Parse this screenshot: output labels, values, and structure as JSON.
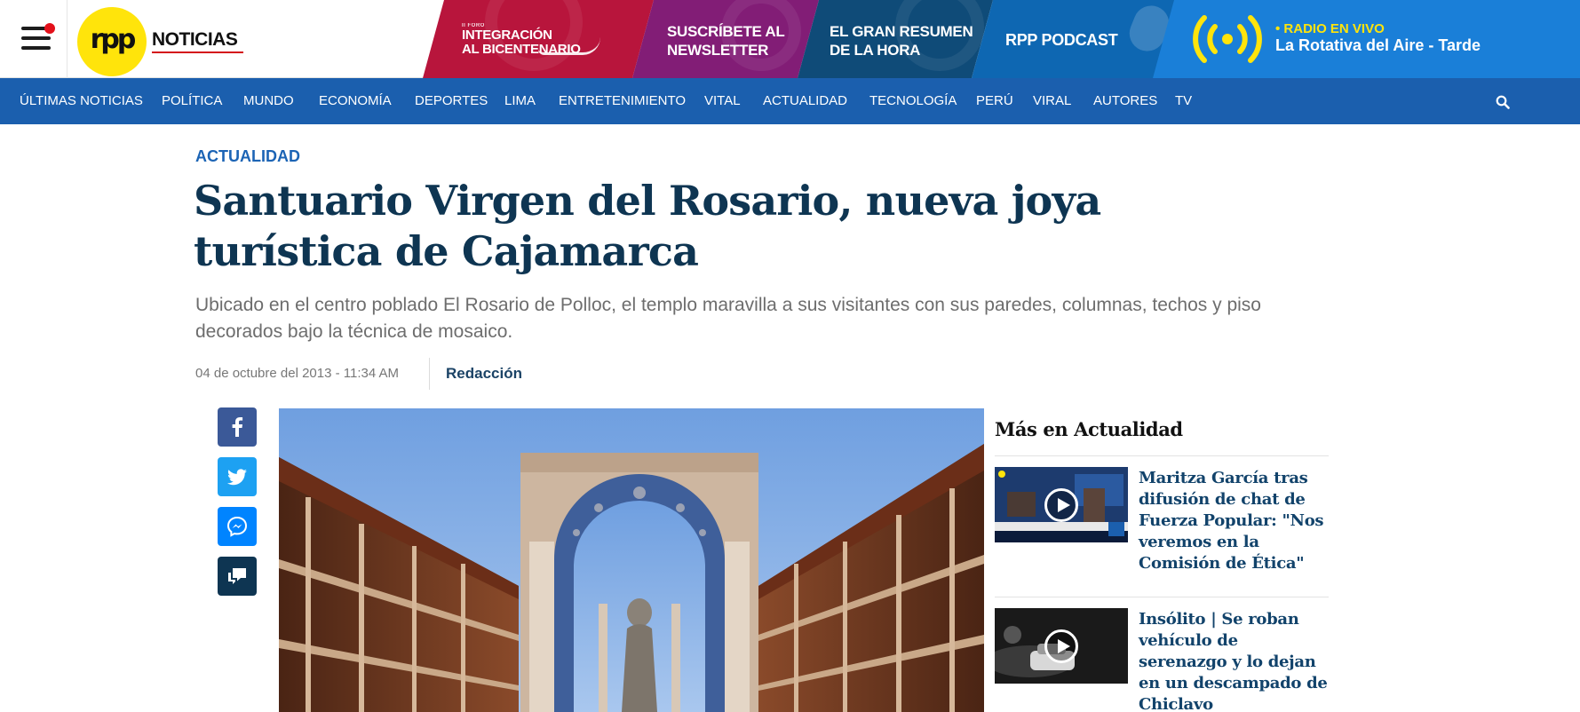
{
  "header": {
    "logo_mark": "RPP",
    "logo_text": "NOTICIAS",
    "promos": [
      {
        "small": "II FORO",
        "line1": "INTEGRACIÓN",
        "line2": "AL BICENTENARIO"
      },
      {
        "line1": "SUSCRÍBETE AL",
        "line2": "NEWSLETTER"
      },
      {
        "line1": "EL GRAN RESUMEN",
        "line2": "DE LA HORA"
      },
      {
        "line1": "RPP PODCAST"
      }
    ],
    "radio": {
      "label": "• RADIO EN VIVO",
      "show": "La Rotativa del Aire - Tarde"
    }
  },
  "nav": {
    "items": [
      "ÚLTIMAS NOTICIAS",
      "POLÍTICA",
      "MUNDO",
      "ECONOMÍA",
      "DEPORTES",
      "LIMA",
      "ENTRETENIMIENTO",
      "VITAL",
      "ACTUALIDAD",
      "TECNOLOGÍA",
      "PERÚ",
      "VIRAL",
      "AUTORES",
      "TV"
    ]
  },
  "article": {
    "section": "ACTUALIDAD",
    "title": "Santuario Virgen del Rosario, nueva joya turística de Cajamarca",
    "summary": "Ubicado en el centro poblado El Rosario de Polloc, el templo maravilla a sus visitantes con sus paredes, columnas, techos y piso decorados bajo la técnica de mosaico.",
    "date": "04 de octubre del 2013 - 11:34 AM",
    "author": "Redacción"
  },
  "share": [
    "facebook-icon",
    "twitter-icon",
    "messenger-icon",
    "comments-icon"
  ],
  "sidebar": {
    "title": "Más en Actualidad",
    "items": [
      {
        "headline": "Maritza García tras difusión de chat de Fuerza Popular: \"Nos veremos en la Comisión de Ética\""
      },
      {
        "headline": "Insólito | Se roban vehículo de serenazgo y lo dejan en un descampado de Chiclavo"
      }
    ]
  },
  "colors": {
    "nav": "#1b5fae",
    "headline": "#0e3552",
    "kicker": "#1c64b5",
    "logo_yellow": "#ffe40b",
    "facebook": "#3b5998",
    "twitter": "#1da1f2",
    "messenger": "#0084ff",
    "comments": "#0e3552"
  }
}
